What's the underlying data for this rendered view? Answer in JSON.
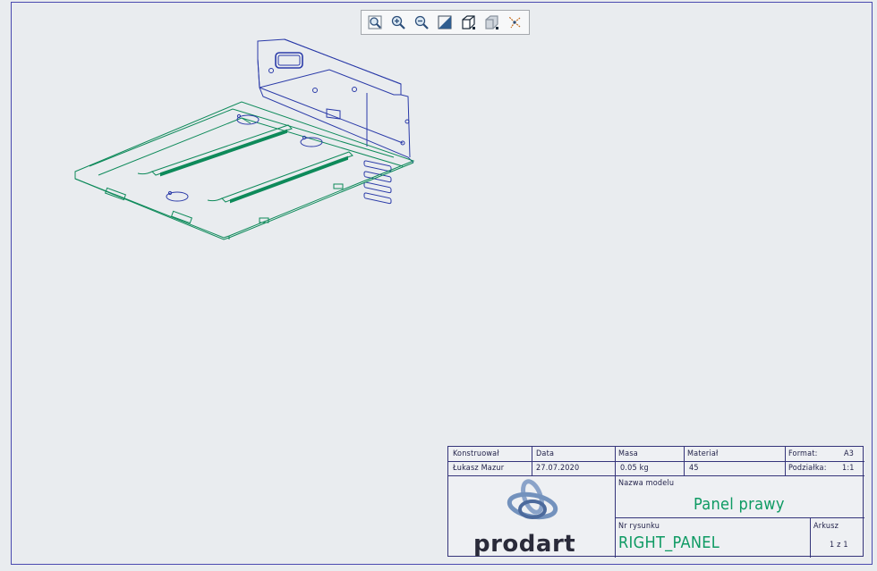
{
  "toolbar": {
    "buttons": [
      {
        "name": "zoom-fit-icon"
      },
      {
        "name": "zoom-in-icon"
      },
      {
        "name": "zoom-out-icon"
      },
      {
        "name": "shading-icon"
      },
      {
        "name": "view-cube-icon"
      },
      {
        "name": "render-mode-icon"
      },
      {
        "name": "explode-icon"
      }
    ]
  },
  "title_block": {
    "designer_label": "Konstruował",
    "designer_value": "Łukasz Mazur",
    "date_label": "Data",
    "date_value": "27.07.2020",
    "mass_label": "Masa",
    "mass_value": "0.05 kg",
    "material_label": "Materiał",
    "material_value": "45",
    "format_label": "Format:",
    "format_value": "A3",
    "scale_label": "Podziałka:",
    "scale_value": "1:1",
    "model_name_label": "Nazwa modelu",
    "model_name_value": "Panel prawy",
    "drawing_no_label": "Nr rysunku",
    "drawing_no_value": "RIGHT_PANEL",
    "sheet_label": "Arkusz",
    "sheet_value": "1 z 1",
    "logo_text": "prodart"
  },
  "colors": {
    "edge_blue": "#2a3aa8",
    "edge_green": "#0e8a5a",
    "accent_green": "#0e9a63",
    "border": "#35357a"
  }
}
